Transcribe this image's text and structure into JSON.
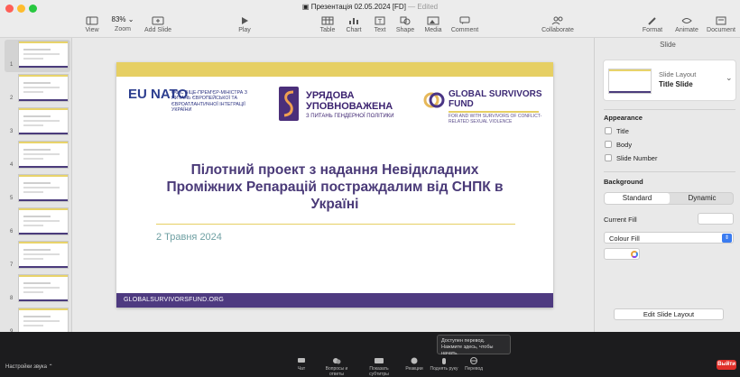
{
  "window": {
    "title": "Презентація 02.05.2024 [FD]",
    "status": "Edited"
  },
  "toolbar": {
    "view": "View",
    "zoom_value": "83%",
    "zoom": "Zoom",
    "add_slide": "Add Slide",
    "play": "Play",
    "table": "Table",
    "chart": "Chart",
    "text": "Text",
    "shape": "Shape",
    "media": "Media",
    "comment": "Comment",
    "collaborate": "Collaborate",
    "format": "Format",
    "animate": "Animate",
    "document": "Document"
  },
  "sidebar": {
    "slide_numbers": [
      "1",
      "2",
      "3",
      "4",
      "5",
      "6",
      "7",
      "8",
      "9"
    ]
  },
  "slide": {
    "logo1_mark": "EU NATO",
    "logo1_text": "ОФІС ВІЦЕ-ПРЕМ'ЄР-МІНІСТРА З ПИТАНЬ ЄВРОПЕЙСЬКОЇ ТА ЄВРОАТЛАНТИЧНОЇ ІНТЕГРАЦІЇ УКРАЇНИ",
    "logo2_title": "УРЯДОВА УПОВНОВАЖЕНА",
    "logo2_sub": "З ПИТАНЬ ГЕНДЕРНОЇ ПОЛІТИКИ",
    "logo3_title": "GLOBAL SURVIVORS FUND",
    "logo3_sub": "FOR AND WITH SURVIVORS OF CONFLICT-RELATED SEXUAL VIOLENCE",
    "title": "Пілотний проект з надання Невідкладних Проміжних Репарацій постраждалим від СНПК в Україні",
    "date": "2 Травня 2024",
    "footer": "GLOBALSURVIVORSFUND.ORG"
  },
  "inspector": {
    "header": "Slide",
    "layout_label": "Slide Layout",
    "layout_value": "Title Slide",
    "appearance": "Appearance",
    "checkboxes": [
      "Title",
      "Body",
      "Slide Number"
    ],
    "background": "Background",
    "seg_standard": "Standard",
    "seg_dynamic": "Dynamic",
    "current_fill": "Current Fill",
    "colour_fill": "Colour Fill",
    "edit_layout": "Edit Slide Layout"
  },
  "zoom_bar": {
    "audio": "Настройки звука",
    "tooltip": "Доступен перевод. Нажмите здесь, чтобы начать.",
    "items": [
      "Чат",
      "Вопросы и ответы",
      "Показать субтитры",
      "Реакции",
      "Поднять руку",
      "Перевод"
    ],
    "leave": "Выйти"
  },
  "colors": {
    "accent_yellow": "#e6cf63",
    "accent_purple": "#4e3a80",
    "date_teal": "#6fa0a3",
    "leave_red": "#e0302a"
  }
}
